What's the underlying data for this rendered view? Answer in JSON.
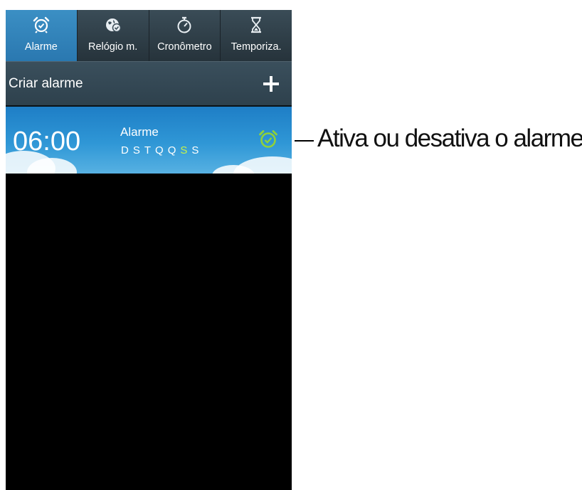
{
  "tabs": [
    {
      "label": "Alarme",
      "icon": "alarm-clock-icon",
      "active": true
    },
    {
      "label": "Relógio m.",
      "icon": "world-clock-icon",
      "active": false
    },
    {
      "label": "Cronômetro",
      "icon": "stopwatch-icon",
      "active": false
    },
    {
      "label": "Temporiza.",
      "icon": "hourglass-icon",
      "active": false
    }
  ],
  "create_alarm": {
    "label": "Criar alarme",
    "icon": "plus-icon"
  },
  "alarms": [
    {
      "time": "06:00",
      "name": "Alarme",
      "days": [
        "D",
        "S",
        "T",
        "Q",
        "Q",
        "S",
        "S"
      ],
      "active_days": [
        false,
        false,
        false,
        false,
        false,
        true,
        false
      ],
      "enabled": true,
      "toggle_icon": "alarm-toggle-icon"
    }
  ],
  "callout": {
    "text": "Ativa ou desativa o alarme"
  },
  "colors": {
    "active_tab": "#3b8fc4",
    "active_day": "#c6f24a",
    "alarm_icon_on": "#8fd13a",
    "background": "#000000"
  }
}
